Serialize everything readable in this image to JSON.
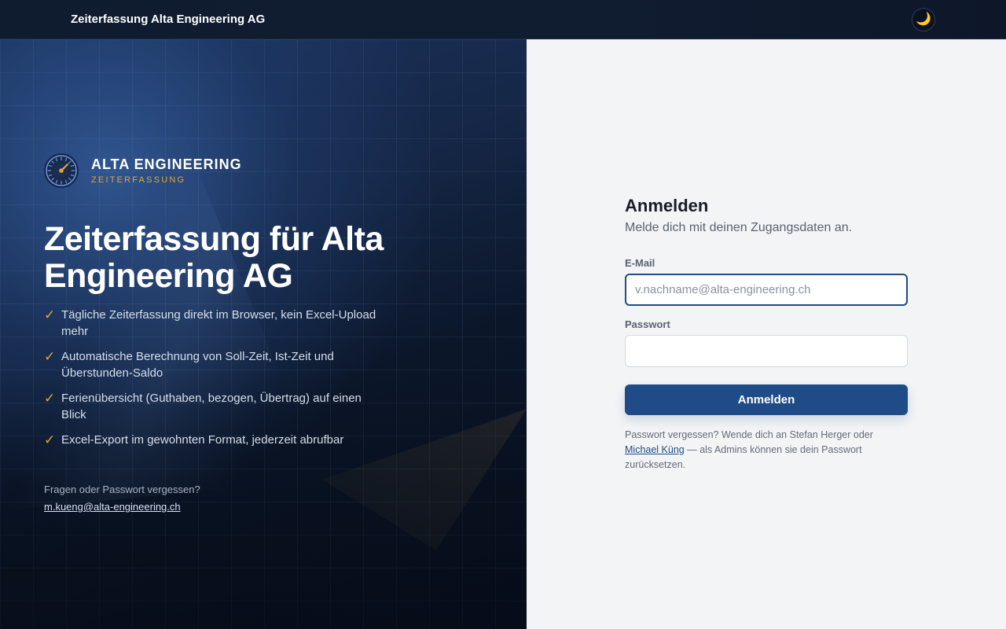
{
  "topbar": {
    "app_title": "Zeiterfassung Alta Engineering AG",
    "theme_toggle_icon": "moon-icon",
    "theme_toggle_glyph": "🌙"
  },
  "hero": {
    "brand_name": "ALTA ENGINEERING",
    "brand_sub": "ZEITERFASSUNG",
    "logo_icon": "gauge-icon",
    "title": "Zeiterfassung für Alta Engineering AG",
    "features": [
      "Tägliche Zeiterfassung direkt im Browser, kein Excel-Upload mehr",
      "Automatische Berechnung von Soll-Zeit, Ist-Zeit und Überstunden-Saldo",
      "Ferienübersicht (Guthaben, bezogen, Übertrag) auf einen Blick",
      "Excel-Export im gewohnten Format, jederzeit abrufbar"
    ],
    "check_glyph": "✓",
    "help_question": "Fragen oder Passwort vergessen?",
    "help_email": "m.kueng@alta-engineering.ch"
  },
  "login": {
    "title": "Anmelden",
    "subtitle": "Melde dich mit deinen Zugangsdaten an.",
    "email_label": "E-Mail",
    "email_value": "",
    "email_placeholder": "v.nachname@alta-engineering.ch",
    "password_label": "Passwort",
    "password_value": "",
    "submit_label": "Anmelden",
    "hint_prefix": "Passwort vergessen? Wende dich an Stefan Herger oder ",
    "hint_link": "Michael Küng",
    "hint_suffix": " — als Admins können sie dein Passwort zurücksetzen."
  },
  "colors": {
    "accent": "#1f4b86",
    "gold": "#e0a63a",
    "topbar_bg": "#0f1b2e",
    "form_bg": "#f3f4f6"
  }
}
